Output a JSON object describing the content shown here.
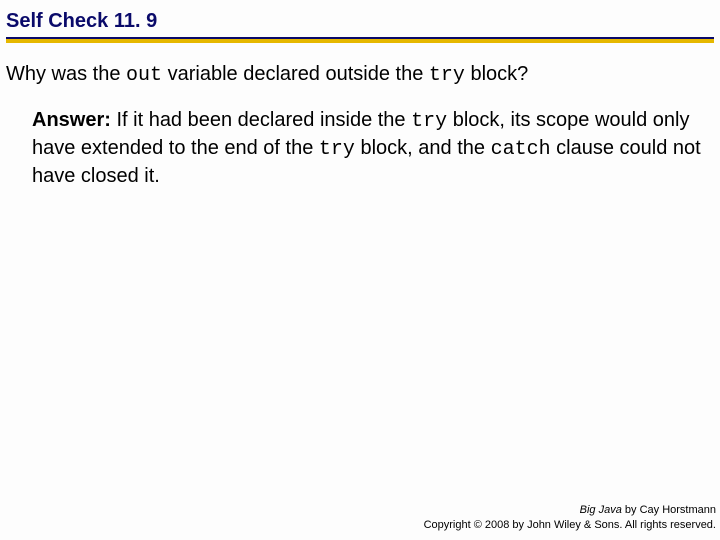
{
  "header": {
    "title": "Self Check 11. 9"
  },
  "question": {
    "pre": "Why was the ",
    "code1": "out",
    "mid": " variable declared outside the ",
    "code2": "try",
    "post": " block?"
  },
  "answer": {
    "label": "Answer:",
    "t1": " If it had been declared inside the ",
    "c1": "try",
    "t2": " block, its scope would only have extended to the end of the ",
    "c2": "try",
    "t3": " block, and the ",
    "c3": "catch",
    "t4": " clause could not have closed it."
  },
  "footer": {
    "book": "Big Java",
    "by": " by Cay Horstmann",
    "copyright": "Copyright © 2008 by John Wiley & Sons. All rights reserved."
  }
}
